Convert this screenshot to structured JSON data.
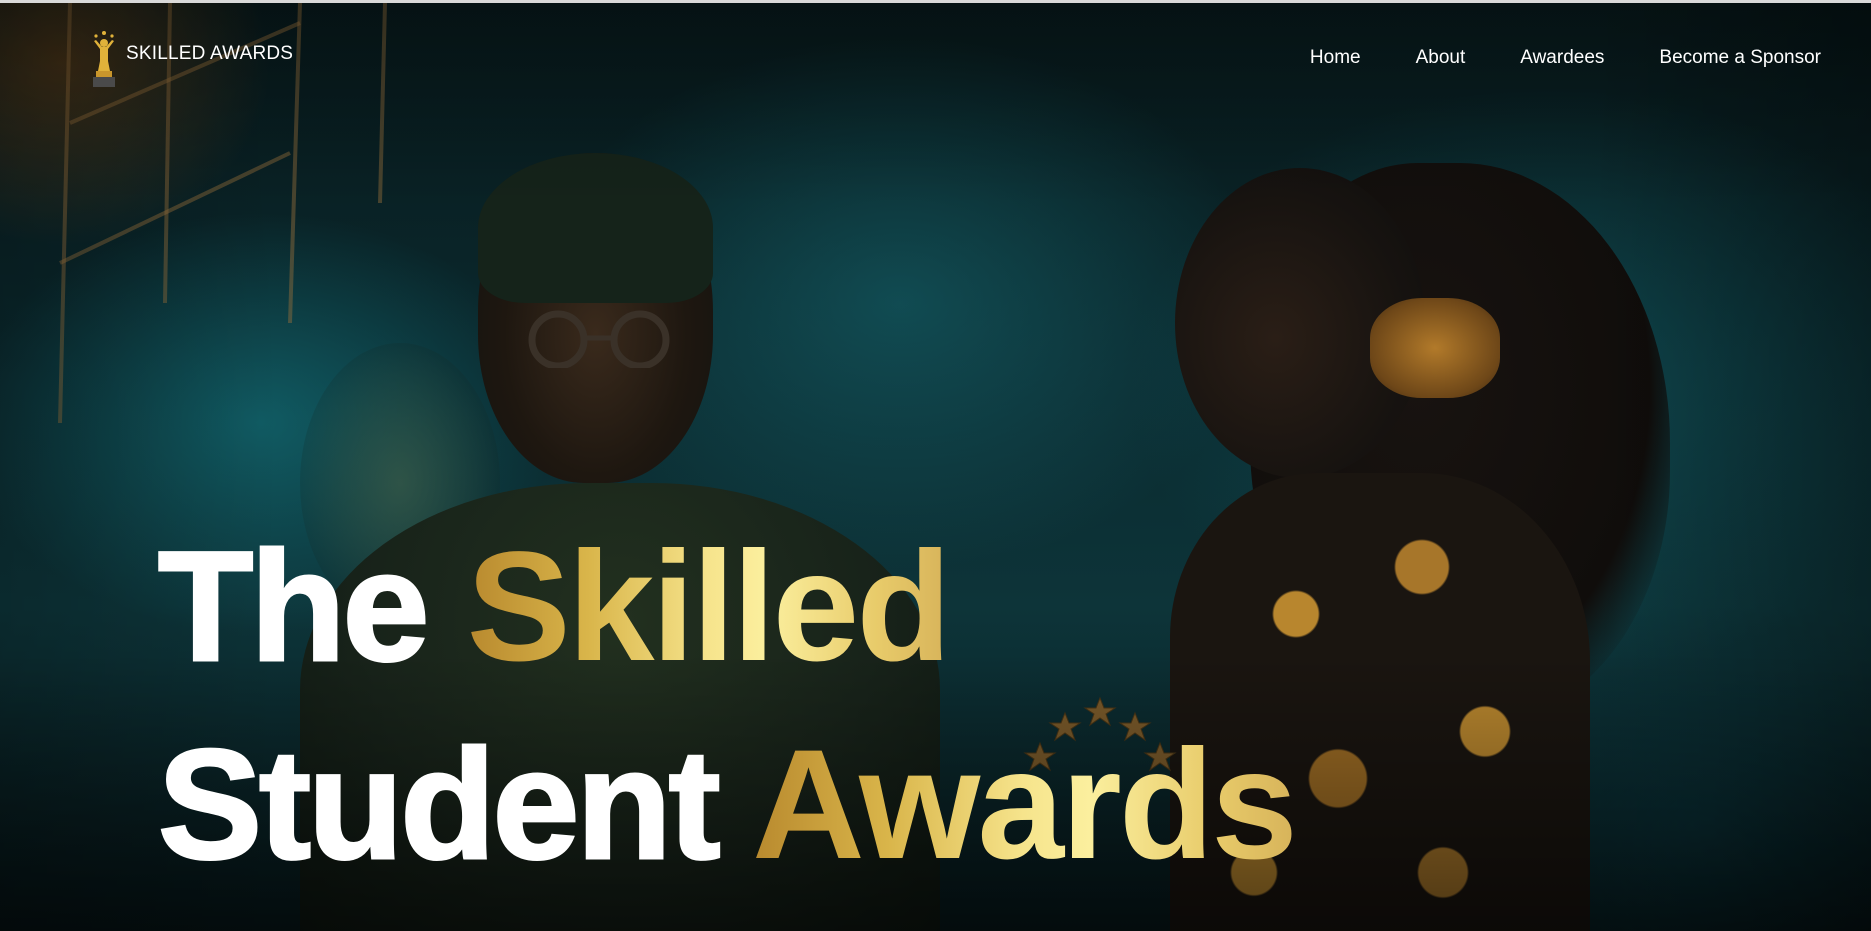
{
  "header": {
    "logo_text": "SKILLED AWARDS",
    "nav": [
      {
        "label": "Home"
      },
      {
        "label": "About"
      },
      {
        "label": "Awardees"
      },
      {
        "label": "Become a Sponsor"
      }
    ]
  },
  "hero": {
    "line1_white": "The",
    "line1_gold": "Skilled",
    "line2_white": "Student",
    "line2_gold": "Awards"
  },
  "colors": {
    "accent_gold": "#f6e48c",
    "gold_dark": "#b8892e",
    "text_white": "#ffffff",
    "background_teal": "#0d3439"
  },
  "icons": {
    "logo": "trophy-icon"
  }
}
